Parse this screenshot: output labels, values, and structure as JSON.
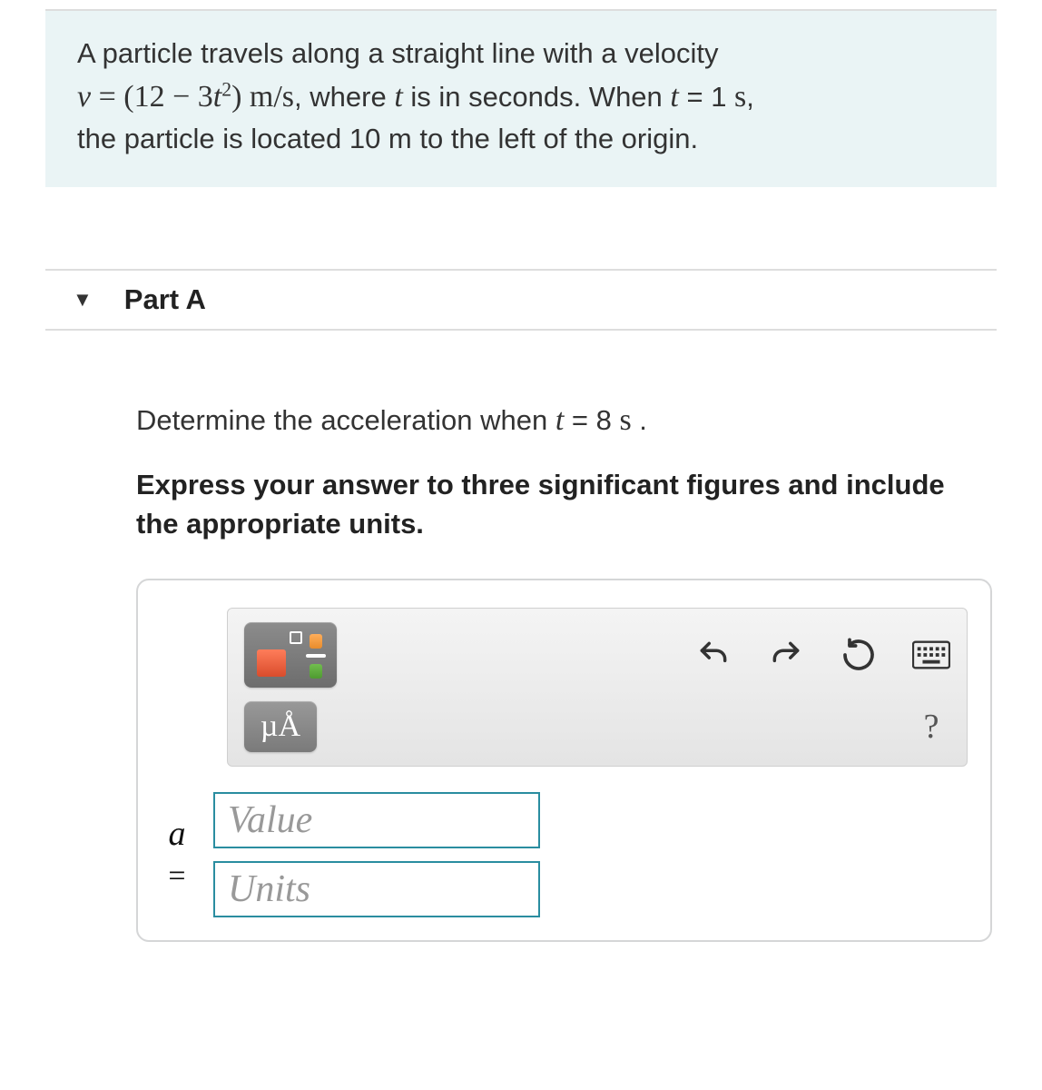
{
  "problem": {
    "line1": "A particle travels along a straight line with a velocity",
    "eq_var": "v",
    "eq_eq": " = ",
    "eq_open": "(12 − 3",
    "eq_t": "t",
    "eq_sup": "2",
    "eq_close": ") ",
    "eq_unit": "m/s",
    "line2a": ", where ",
    "line2_t": "t",
    "line2b": " is in seconds. When ",
    "line2_t2": "t",
    "line2c": " = 1 ",
    "line2_s": "s",
    "line2d": ",",
    "line3": "the particle is located 10 m to the left of the origin."
  },
  "part": {
    "title": "Part A",
    "prompt1": "Determine the acceleration when ",
    "prompt_t": "t",
    "prompt2": " = 8  ",
    "prompt_s": "s",
    "prompt3": " .",
    "instr": "Express your answer to three significant figures and include the appropriate units."
  },
  "toolbar": {
    "template_label": "templates-button",
    "mu_label": "µÅ",
    "undo": "undo",
    "redo": "redo",
    "reset": "reset",
    "keyboard": "keyboard",
    "help": "?"
  },
  "answer": {
    "var": "a",
    "eq": "=",
    "value_placeholder": "Value",
    "units_placeholder": "Units"
  }
}
